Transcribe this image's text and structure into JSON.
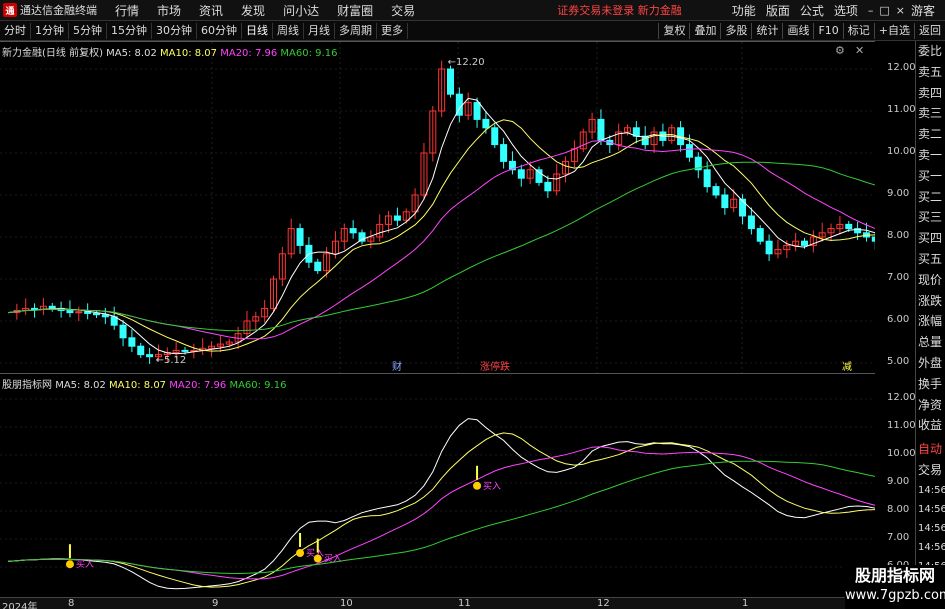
{
  "app": {
    "title": "通达信金融终端",
    "menu": [
      "行情",
      "市场",
      "资讯",
      "发现",
      "问小达",
      "财富圈",
      "交易"
    ],
    "warning": "证券交易未登录",
    "stock_name_red": "新力金融",
    "right_menu": [
      "功能",
      "版面",
      "公式",
      "选项"
    ],
    "guest": "游客"
  },
  "toolbar": {
    "periods": [
      "分时",
      "1分钟",
      "5分钟",
      "15分钟",
      "30分钟",
      "60分钟",
      "日线",
      "周线",
      "月线",
      "多周期",
      "更多"
    ],
    "active_period": "日线",
    "right_buttons": [
      "复权",
      "叠加",
      "多股",
      "统计",
      "画线",
      "F10",
      "标记",
      "+自选",
      "返回"
    ]
  },
  "main_panel": {
    "title": "新力金融(日线 前复权)",
    "ma5": "MA5: 8.02",
    "ma10": "MA10: 8.07",
    "ma20": "MA20: 7.96",
    "ma60": "MA60: 9.16",
    "yticks": [
      "12.00",
      "11.00",
      "10.00",
      "9.00",
      "8.00",
      "7.00",
      "6.00",
      "5.00"
    ],
    "high_label": "12.20",
    "low_label": "5.12",
    "markers": [
      "财",
      "涨停",
      "跌",
      "减"
    ]
  },
  "sub_panel": {
    "title": "股朋指标网",
    "ma5": "MA5: 8.02",
    "ma10": "MA10: 8.07",
    "ma20": "MA20: 7.96",
    "ma60": "MA60: 9.16",
    "yticks": [
      "12.00",
      "11.00",
      "10.00",
      "9.00",
      "8.00",
      "7.00",
      "6.00"
    ],
    "signal_labels": [
      "买入",
      "买入",
      "买入",
      "买入"
    ]
  },
  "sidebar": {
    "items": [
      "委比",
      "卖五",
      "卖四",
      "卖三",
      "卖二",
      "卖一",
      "买一",
      "买二",
      "买三",
      "买四",
      "买五",
      "现价",
      "涨跌",
      "涨幅",
      "总量",
      "外盘",
      "换手",
      "净资",
      "收益"
    ],
    "lower_items": [
      "自动",
      "交易"
    ],
    "lower_times": [
      "14:56",
      "14:56",
      "14:56",
      "14:56",
      "14:56",
      "14:56",
      "14:56",
      "14:56"
    ]
  },
  "dates": [
    "2024年",
    "8",
    "9",
    "10",
    "11",
    "12",
    "1"
  ],
  "watermark": {
    "line1": "股朋指标网",
    "line2": "www.7gpzb.com"
  },
  "colors": {
    "ma5": "#ffffff",
    "ma10": "#ffff66",
    "ma20": "#ff44ff",
    "ma60": "#33cc33",
    "up": "#ff3333",
    "down": "#33ffff"
  },
  "chart_data": {
    "type": "candlestick",
    "series": [
      {
        "name": "MA5"
      },
      {
        "name": "MA10"
      },
      {
        "name": "MA20"
      },
      {
        "name": "MA60"
      }
    ]
  }
}
